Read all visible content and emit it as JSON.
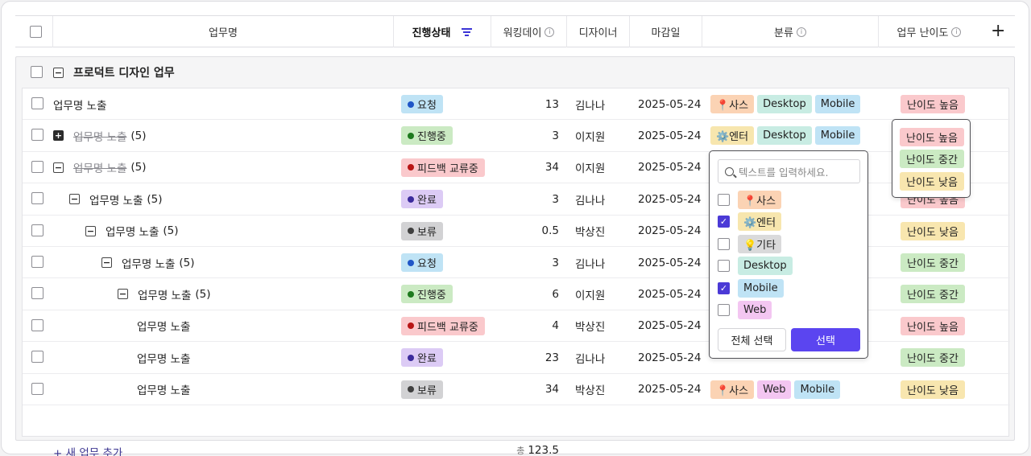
{
  "header": {
    "title": "업무명",
    "status": "진행상태",
    "workday": "워킹데이",
    "designer": "디자이너",
    "deadline": "마감일",
    "category": "분류",
    "difficulty": "업무 난이도",
    "add_column": "+"
  },
  "group": {
    "title": "프로덕트 디자인 업무",
    "toggle": "−"
  },
  "rows": [
    {
      "name": "업무명 노출",
      "count": "",
      "status": "요청",
      "days": "13",
      "designer": "김나나",
      "date": "2025-05-24",
      "level": "난이도 높음"
    },
    {
      "name": "업무명 노출",
      "count": "(5)",
      "status": "진행중",
      "days": "3",
      "designer": "이지원",
      "date": "2025-05-24",
      "level": ""
    },
    {
      "name": "업무명 노출",
      "count": "(5)",
      "status": "피드백 교류중",
      "days": "34",
      "designer": "이지원",
      "date": "2025-05-24",
      "level": ""
    },
    {
      "name": "업무명 노출",
      "count": "(5)",
      "status": "완료",
      "days": "3",
      "designer": "김나나",
      "date": "2025-05-24",
      "level": "난이도 높음"
    },
    {
      "name": "업무명 노출",
      "count": "(5)",
      "status": "보류",
      "days": "0.5",
      "designer": "박상진",
      "date": "2025-05-24",
      "level": "난이도 낮음"
    },
    {
      "name": "업무명 노출",
      "count": "(5)",
      "status": "요청",
      "days": "3",
      "designer": "김나나",
      "date": "2025-05-24",
      "level": "난이도 중간"
    },
    {
      "name": "업무명 노출",
      "count": "(5)",
      "status": "진행중",
      "days": "6",
      "designer": "이지원",
      "date": "2025-05-24",
      "level": "난이도 중간"
    },
    {
      "name": "업무명 노출",
      "count": "",
      "status": "피드백 교류중",
      "days": "4",
      "designer": "박상진",
      "date": "2025-05-24",
      "level": "난이도 높음"
    },
    {
      "name": "업무명 노출",
      "count": "",
      "status": "완료",
      "days": "23",
      "designer": "김나나",
      "date": "2025-05-24",
      "level": "난이도 중간"
    },
    {
      "name": "업무명 노출",
      "count": "",
      "status": "보류",
      "days": "34",
      "designer": "박상진",
      "date": "2025-05-24",
      "level": "난이도 낮음"
    }
  ],
  "row_tags": {
    "r0": [
      "📍사스",
      "Desktop",
      "Mobile"
    ],
    "r1": [
      "⚙️엔터",
      "Desktop",
      "Mobile"
    ],
    "r9": [
      "📍사스",
      "Web",
      "Mobile"
    ]
  },
  "footer": {
    "add_task": "+ 새 업무 추가",
    "total_label": "총",
    "total_value": "123.5"
  },
  "category_dropdown": {
    "placeholder": "텍스트를 입력하세요.",
    "options": [
      {
        "label": "📍사스",
        "checked": false
      },
      {
        "label": "⚙️엔터",
        "checked": true
      },
      {
        "label": "💡기타",
        "checked": false
      },
      {
        "label": "Desktop",
        "checked": false
      },
      {
        "label": "Mobile",
        "checked": true
      },
      {
        "label": "Web",
        "checked": false
      }
    ],
    "select_all": "전체 선택",
    "select": "선택"
  },
  "level_popover": [
    "난이도 높음",
    "난이도 중간",
    "난이도 낮음"
  ],
  "colors": {
    "accent": "#5b45f0",
    "status_요청": "#bfe3f5",
    "status_진행중": "#cbeac3",
    "status_피드백": "#fac9cc",
    "status_완료": "#dccbf5",
    "status_보류": "#d2d2d4",
    "tag_사스": "#fbd3b4",
    "tag_엔터": "#f7e6ae",
    "tag_기타": "#dadadb",
    "tag_desktop": "#c8ece3",
    "tag_mobile": "#bfe3f5",
    "tag_web": "#f3c6f1",
    "level_high": "#fac9cc",
    "level_mid": "#cbeac3",
    "level_low": "#f8e6af"
  }
}
